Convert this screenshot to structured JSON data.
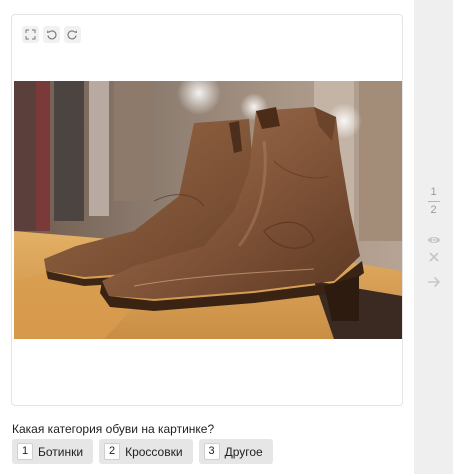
{
  "toolbar": {
    "fullscreen_icon": "fullscreen-icon",
    "rotate_left_icon": "rotate-left-icon",
    "rotate_right_icon": "rotate-right-icon"
  },
  "task": {
    "question": "Какая категория обуви на картинке?",
    "answers": [
      {
        "hotkey": "1",
        "label": "Ботинки"
      },
      {
        "hotkey": "2",
        "label": "Кроссовки"
      },
      {
        "hotkey": "3",
        "label": "Другое"
      }
    ]
  },
  "side_panel": {
    "page_current": "1",
    "page_total": "2",
    "icons": [
      "eye-icon",
      "close-icon",
      "arrow-right-icon"
    ]
  },
  "colors": {
    "side_panel_bg": "#efefef",
    "button_bg": "#e6e6e6",
    "boot_leather": "#7a4f34"
  }
}
